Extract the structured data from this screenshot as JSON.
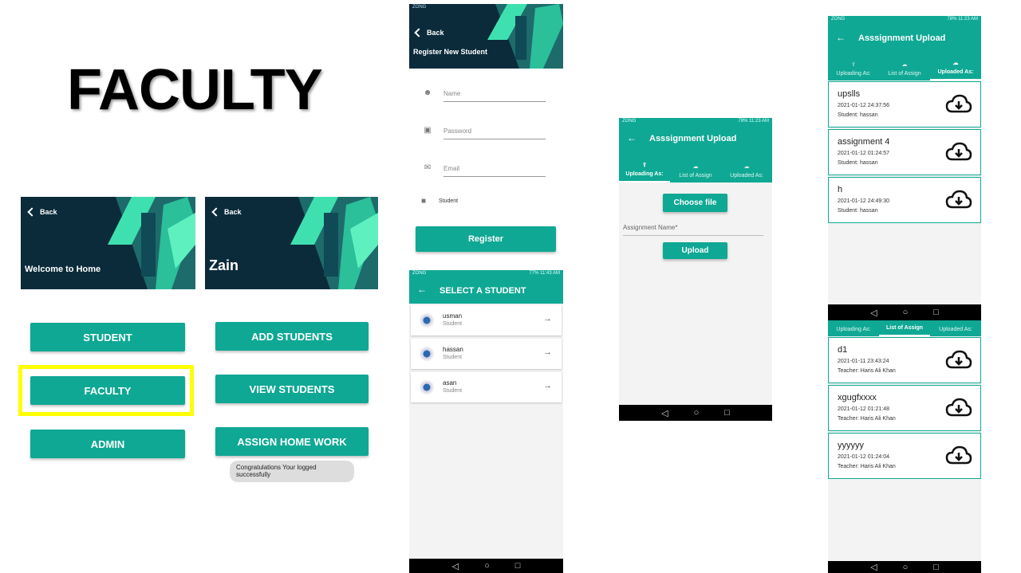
{
  "slide_title": "FACULTY",
  "screen1": {
    "back": "Back",
    "title": "Welcome to Home",
    "buttons": [
      "STUDENT",
      "FACULTY",
      "ADMIN"
    ]
  },
  "screen2": {
    "back": "Back",
    "title": "Zain",
    "buttons": [
      "ADD STUDENTS",
      "VIEW STUDENTS",
      "ASSIGN HOME WORK"
    ],
    "toast": "Congratulations Your logged successfully"
  },
  "register": {
    "status_left": "ZONG",
    "back": "Back",
    "title": "Register New Student",
    "name_placeholder": "Name",
    "password_placeholder": "Password",
    "email_placeholder": "Email",
    "role": "Student",
    "register_button": "Register"
  },
  "select": {
    "status_left": "ZONG",
    "status_right": "77% 11:43 AM",
    "title": "SELECT A STUDENT",
    "students": [
      {
        "name": "usman",
        "role": "Student"
      },
      {
        "name": "hassan",
        "role": "Student"
      },
      {
        "name": "asan",
        "role": "Student"
      }
    ]
  },
  "upload_screen": {
    "status_left": "ZONG",
    "status_right": "78% 11:23 AM",
    "title": "Asssignment Upload",
    "tabs": [
      "Uploading As:",
      "List of Assign",
      "Uploaded As:"
    ],
    "choose_file": "Choose file",
    "assignment_name_placeholder": "Assignment Name*",
    "upload_button": "Upload"
  },
  "uploaded_screen": {
    "status_left": "ZONG",
    "status_right": "78% 11:23 AM",
    "title": "Asssignment Upload",
    "tabs": [
      "Uploading As:",
      "List of Assign",
      "Uploaded As:"
    ],
    "items": [
      {
        "title": "upslls",
        "date": "2021-01-12  24:37:56",
        "by": "Student: hassan"
      },
      {
        "title": "assignment 4",
        "date": "2021-01-12  01:24:57",
        "by": "Student: hassan"
      },
      {
        "title": "h",
        "date": "2021-01-12  24:49:30",
        "by": "Student: hassan"
      }
    ]
  },
  "list_screen": {
    "tabs": [
      "Uploading As:",
      "List of Assign",
      "Uploaded As:"
    ],
    "items": [
      {
        "title": "d1",
        "date": "2021-01-11  23:43:24",
        "by": "Teacher: Haris Ali Khan"
      },
      {
        "title": "xgugfxxxx",
        "date": "2021-01-12  01:21:48",
        "by": "Teacher: Haris Ali Khan"
      },
      {
        "title": "yyyyyy",
        "date": "2021-01-12  01:24:04",
        "by": "Teacher: Haris Ali Khan"
      }
    ]
  },
  "colors": {
    "accent": "#0fa894",
    "header_dark": "#0b2b3b",
    "highlight": "#ffff00"
  }
}
